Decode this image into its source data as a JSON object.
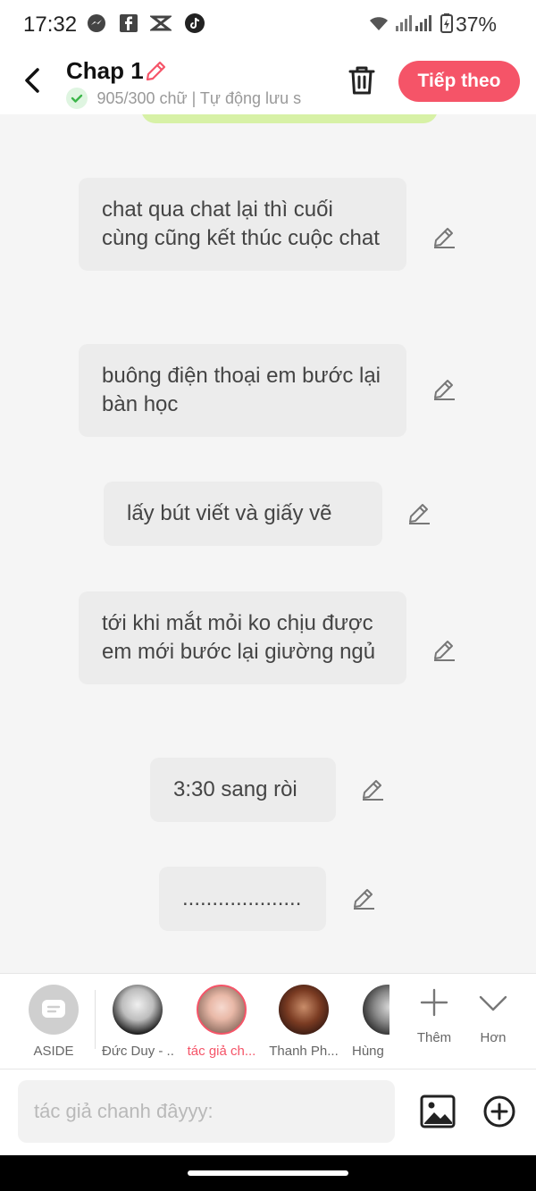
{
  "status_bar": {
    "time": "17:32",
    "battery": "37%",
    "icons": [
      "messenger-icon",
      "facebook-icon",
      "capcut-icon",
      "tiktok-icon",
      "wifi-icon",
      "signal-icon",
      "signal-icon",
      "battery-icon"
    ]
  },
  "header": {
    "title": "Chap 1",
    "subtitle": "905/300 chữ | Tự động lưu s",
    "next_label": "Tiếp theo",
    "accent": "#f55468"
  },
  "messages": [
    {
      "text": "chat qua chat lại thì cuối cùng cũng kết thúc cuộc chat"
    },
    {
      "text": "buông điện thoại em bước lại bàn học"
    },
    {
      "text": "lấy bút viết và giấy vẽ"
    },
    {
      "text": "tới khi mắt mỏi ko chịu được em mới bước lại giường ngủ"
    },
    {
      "text": "3:30 sang ròi"
    },
    {
      "text": "...................."
    }
  ],
  "characters": [
    {
      "label": "ASIDE"
    },
    {
      "label": "Đức Duy - ..."
    },
    {
      "label": "tác giả ch..."
    },
    {
      "label": "Thanh Ph..."
    },
    {
      "label": "Hùng"
    }
  ],
  "controls": {
    "more_label": "Thêm",
    "collapse_label": "Hơn"
  },
  "input": {
    "placeholder": "tác giả chanh đâyyy:"
  }
}
